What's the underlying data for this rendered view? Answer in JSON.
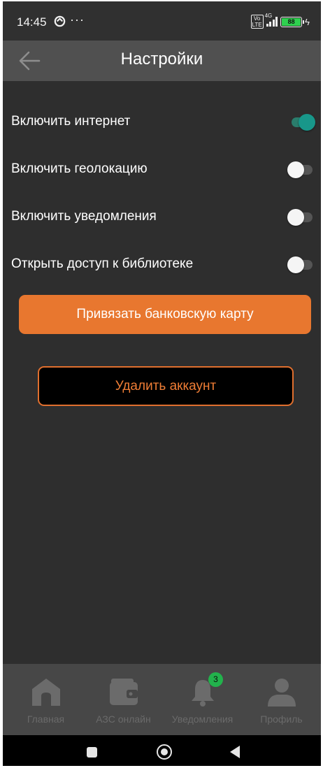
{
  "status_bar": {
    "time": "14:45",
    "more": "···",
    "volte": "Vo\nLTE",
    "network": "4G",
    "battery": "88",
    "icons": [
      "sync-icon",
      "volte-icon",
      "signal-icon",
      "battery-icon",
      "charging-icon"
    ]
  },
  "header": {
    "title": "Настройки",
    "back_icon": "arrow-left-icon"
  },
  "settings": [
    {
      "label": "Включить интернет",
      "enabled": true
    },
    {
      "label": "Включить геолокацию",
      "enabled": false
    },
    {
      "label": "Включить уведомления",
      "enabled": false
    },
    {
      "label": "Открыть доступ к библиотеке",
      "enabled": false
    }
  ],
  "buttons": {
    "link_card": "Привязать банковскую карту",
    "delete_account": "Удалить аккаунт"
  },
  "bottom_nav": {
    "items": [
      {
        "label": "Главная",
        "icon": "home-icon"
      },
      {
        "label": "АЗС онлайн",
        "icon": "wallet-icon"
      },
      {
        "label": "Уведомления",
        "icon": "bell-icon",
        "badge": "3"
      },
      {
        "label": "Профиль",
        "icon": "user-icon"
      }
    ]
  },
  "colors": {
    "background": "#2e2e2e",
    "header": "#505050",
    "accent_orange": "#e8772f",
    "toggle_on": "#18978a",
    "badge_green": "#22b24c"
  }
}
